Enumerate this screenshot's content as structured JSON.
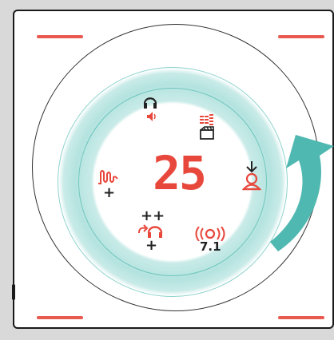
{
  "device": {
    "display_value": "25",
    "indicators": {
      "surround_format": "7.1",
      "plus": "+",
      "plus_plus": "++"
    }
  },
  "colors": {
    "accent": "#e8473c",
    "ring": "#b4e3df",
    "arrow": "#4fb8b1"
  },
  "icons": [
    "headset-speaker-icon",
    "equalizer-scene-icon",
    "bass-wave-icon",
    "download-user-icon",
    "headset-sidetone-icon",
    "surround-sound-icon",
    "rotate-arrow-icon"
  ]
}
